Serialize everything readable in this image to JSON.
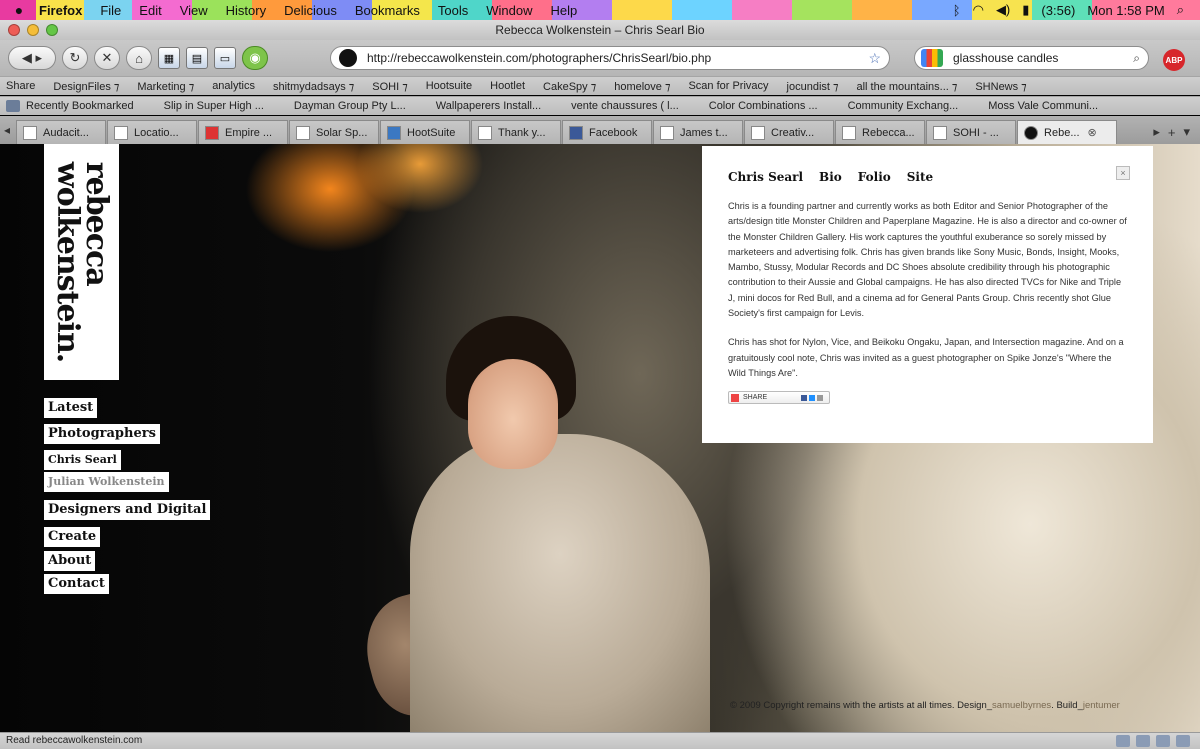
{
  "menubar": {
    "app": "Firefox",
    "items": [
      "File",
      "Edit",
      "View",
      "History",
      "Delicious",
      "Bookmarks",
      "Tools",
      "Window",
      "Help"
    ],
    "battery": "(3:56)",
    "clock": "Mon 1:58 PM"
  },
  "window": {
    "title": "Rebecca Wolkenstein – Chris Searl Bio"
  },
  "toolbar": {
    "url": "http://rebeccawolkenstein.com/photographers/ChrisSearl/bio.php",
    "search_value": "glasshouse candles",
    "abp_label": "ABP"
  },
  "bookmarks1": [
    "Share",
    "DesignFiles ⁊",
    "Marketing ⁊",
    "analytics",
    "shitmydadsays ⁊",
    "SOHI ⁊",
    "Hootsuite",
    "Hootlet",
    "CakeSpy ⁊",
    "homelove ⁊",
    "Scan for Privacy",
    "jocundist ⁊",
    "all the mountains... ⁊",
    "SHNews ⁊"
  ],
  "bookmarks2": [
    "Recently Bookmarked",
    "Slip in Super High ...",
    "Dayman Group Pty L...",
    "Wallpaperers Install...",
    "vente chaussures ( l...",
    "Color Combinations ...",
    "Community Exchang...",
    "Moss Vale Communi..."
  ],
  "tabs": [
    "Audacit...",
    "Locatio...",
    "Empire ...",
    "Solar Sp...",
    "HootSuite",
    "Thank y...",
    "Facebook",
    "James t...",
    "Creativ...",
    "Rebecca...",
    "SOHI - ...",
    "Rebe..."
  ],
  "site": {
    "logo_line1": "rebecca",
    "logo_line2": "wolkenstein.",
    "nav": [
      "Latest",
      "Photographers",
      "Chris Searl",
      "Julian Wolkenstein",
      "Designers and Digital",
      "Create",
      "About",
      "Contact"
    ],
    "bio_tabs": [
      "Chris Searl",
      "Bio",
      "Folio",
      "Site"
    ],
    "close_label": "×",
    "bio_p1": "Chris is a founding partner and currently works as both Editor and Senior Photographer of the arts/design title Monster Children and Paperplane Magazine. He is also a director and co-owner of the Monster Children Gallery. His work captures the youthful exuberance so sorely missed by marketeers and advertising folk. Chris has given brands like Sony Music, Bonds, Insight, Mooks, Mambo, Stussy, Modular Records and DC Shoes absolute credibility through his photographic contribution to their Aussie and Global campaigns. He has also directed TVCs for Nike and Triple J, mini docos for Red Bull, and a cinema ad for General Pants Group.  Chris recently shot Glue Society's first campaign for Levis.",
    "bio_p2": "Chris has shot for Nylon, Vice, and Beikoku Ongaku, Japan, and Intersection magazine. And on a gratuitously cool note, Chris was invited as a guest photographer on Spike Jonze's \"Where the Wild Things Are\".",
    "share_label": "SHARE",
    "footer_text": "© 2009 Copyright remains with the artists at all times. Design_",
    "footer_design": "samuelbyrnes",
    "footer_build_label": ". Build_",
    "footer_build": "jentumer"
  },
  "status": {
    "text": "Read rebeccawolkenstein.com"
  }
}
